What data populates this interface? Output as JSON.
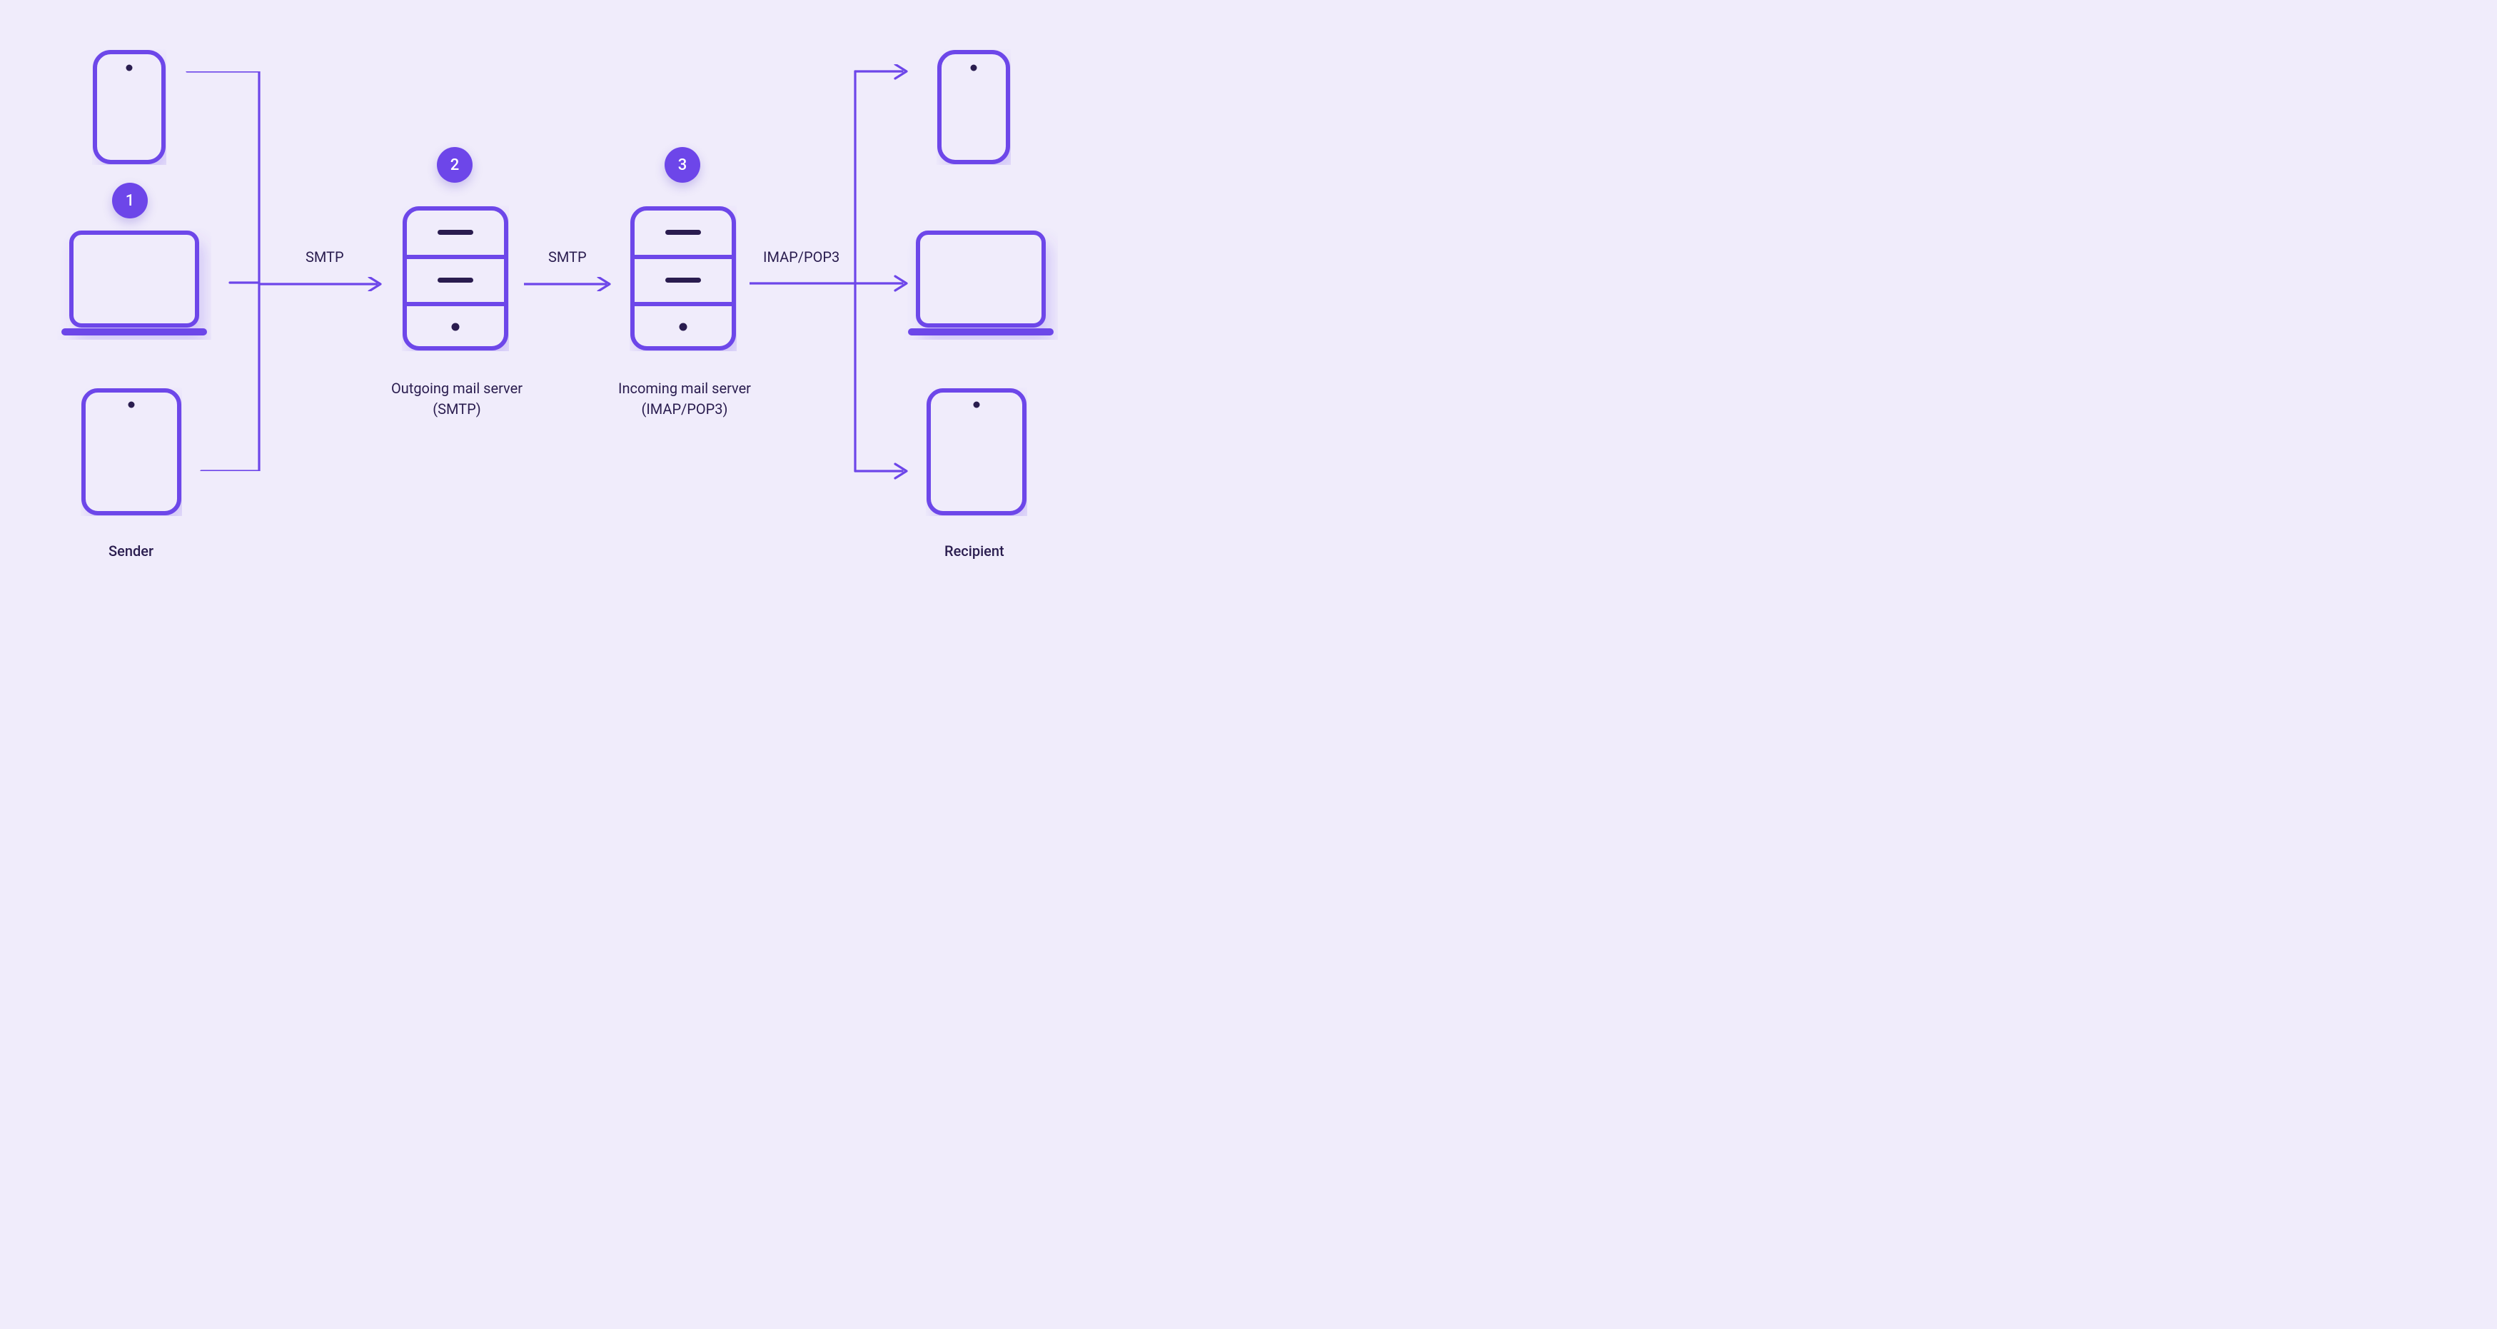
{
  "sender_label": "Sender",
  "recipient_label": "Recipient",
  "badge1": "1",
  "badge2": "2",
  "badge3": "3",
  "arrow1_label": "SMTP",
  "arrow2_label": "SMTP",
  "arrow3_label": "IMAP/POP3",
  "server1_line1": "Outgoing mail server",
  "server1_line2": "(SMTP)",
  "server2_line1": "Incoming mail server",
  "server2_line2": "(IMAP/POP3)",
  "colors": {
    "stroke": "#6d46e9",
    "dark": "#2a1d4f",
    "bg": "#f0ecfb"
  }
}
